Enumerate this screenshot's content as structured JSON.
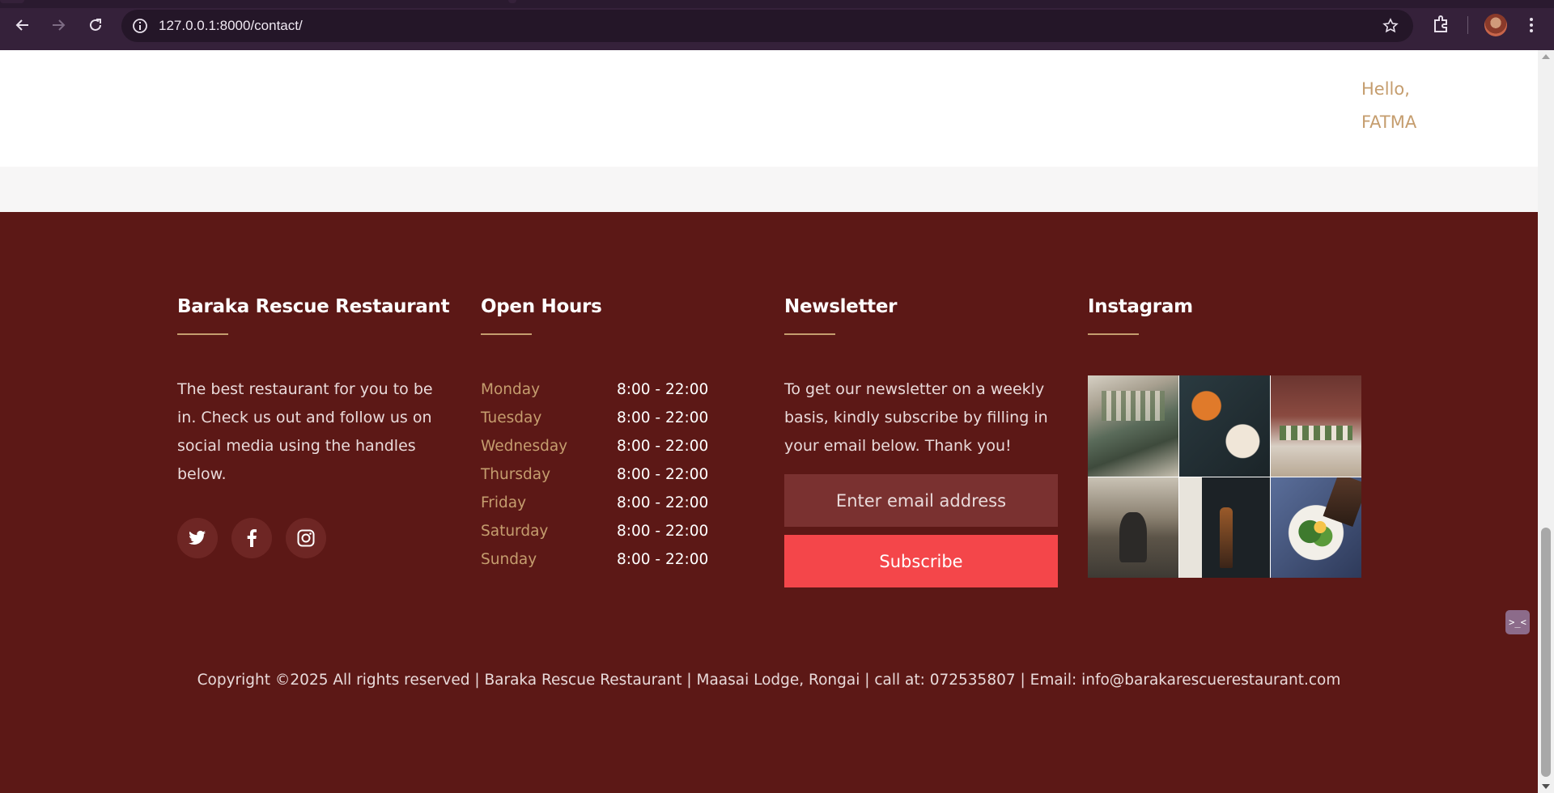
{
  "browser": {
    "url": "127.0.0.1:8000/contact/",
    "icons": [
      "back-icon",
      "forward-icon",
      "reload-icon",
      "site-info-icon",
      "bookmark-star-icon",
      "extensions-icon",
      "profile-avatar",
      "kebab-menu-icon"
    ]
  },
  "header": {
    "greeting_line1": "Hello,",
    "greeting_line2": "FATMA"
  },
  "footer": {
    "about": {
      "title": "Baraka Rescue Restaurant",
      "text": "The best restaurant for you to be in. Check us out and follow us on social media using the handles below.",
      "socials": [
        "twitter-icon",
        "facebook-icon",
        "instagram-icon"
      ]
    },
    "hours": {
      "title": "Open Hours",
      "rows": [
        {
          "day": "Monday",
          "time": "8:00 - 22:00"
        },
        {
          "day": "Tuesday",
          "time": "8:00 - 22:00"
        },
        {
          "day": "Wednesday",
          "time": "8:00 - 22:00"
        },
        {
          "day": "Thursday",
          "time": "8:00 - 22:00"
        },
        {
          "day": "Friday",
          "time": "8:00 - 22:00"
        },
        {
          "day": "Saturday",
          "time": "8:00 - 22:00"
        },
        {
          "day": "Sunday",
          "time": "8:00 - 22:00"
        }
      ]
    },
    "newsletter": {
      "title": "Newsletter",
      "text": "To get our newsletter on a weekly basis, kindly subscribe by filling in your email below. Thank you!",
      "email_placeholder": "Enter email address",
      "subscribe_label": "Subscribe"
    },
    "instagram": {
      "title": "Instagram"
    },
    "copyright": "Copyright ©2025 All rights reserved | Baraka Rescue Restaurant | Maasai Lodge, Rongai | call at: 072535807 | Email: info@barakarescuerestaurant.com"
  },
  "floating_widget": ">_<",
  "colors": {
    "footer_bg": "#5c1816",
    "accent_gold": "#c59d6e",
    "subscribe_red": "#f4464a",
    "input_bg": "#7a3130"
  }
}
